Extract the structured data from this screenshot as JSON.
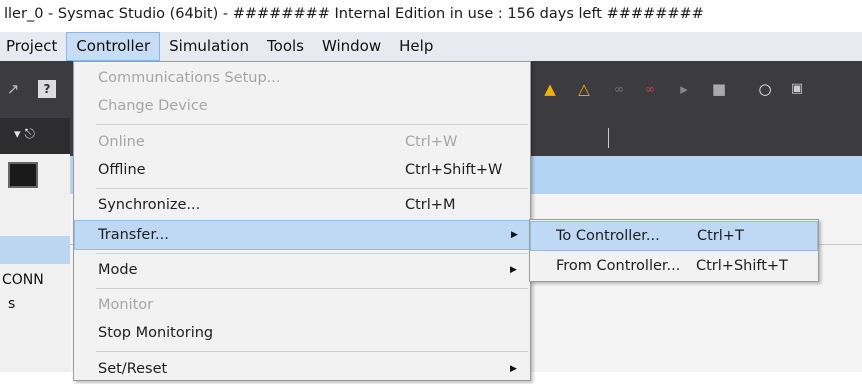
{
  "window": {
    "title": "ller_0 - Sysmac Studio (64bit) - ######## Internal Edition in use : 156 days left ########"
  },
  "menubar": {
    "items": [
      {
        "label": "Project",
        "active": false
      },
      {
        "label": "Controller",
        "active": true
      },
      {
        "label": "Simulation",
        "active": false
      },
      {
        "label": "Tools",
        "active": false
      },
      {
        "label": "Window",
        "active": false
      },
      {
        "label": "Help",
        "active": false
      }
    ]
  },
  "toolbar": {
    "icons": [
      "warning-icon",
      "warning-strike-icon",
      "link-icon",
      "link-red-icon",
      "transfer-to-icon",
      "transfer-from-icon",
      "reset-icon",
      "monitor-icon"
    ]
  },
  "left_panel": {
    "label_1": "CONN",
    "label_2": "s"
  },
  "controller_menu": {
    "communications_setup": "Communications Setup...",
    "change_device": "Change Device",
    "online": "Online",
    "online_shortcut": "Ctrl+W",
    "offline": "Offline",
    "offline_shortcut": "Ctrl+Shift+W",
    "synchronize": "Synchronize...",
    "synchronize_shortcut": "Ctrl+M",
    "transfer": "Transfer...",
    "mode": "Mode",
    "monitor": "Monitor",
    "stop_monitoring": "Stop Monitoring",
    "set_reset": "Set/Reset"
  },
  "transfer_submenu": {
    "to_controller": "To Controller...",
    "to_controller_shortcut": "Ctrl+T",
    "from_controller": "From Controller...",
    "from_controller_shortcut": "Ctrl+Shift+T"
  },
  "colors": {
    "highlight": "#bfd9f5",
    "menu_bg": "#f2f2f2",
    "toolbar_bg": "#3c3c40"
  }
}
